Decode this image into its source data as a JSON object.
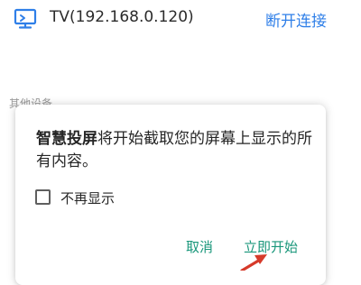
{
  "device": {
    "name": "TV(192.168.0.120)",
    "disconnect_label": "断开连接"
  },
  "section_label": "其他设备",
  "dialog": {
    "message_brand": "智慧投屏",
    "message_rest": "将开始截取您的屏幕上显示的所有内容。",
    "checkbox_label": "不再显示",
    "checkbox_checked": false,
    "cancel_label": "取消",
    "start_label": "立即开始"
  },
  "colors": {
    "link_blue": "#2f7fe8",
    "button_green": "#18967a",
    "annotation_red": "#d63a2a"
  }
}
